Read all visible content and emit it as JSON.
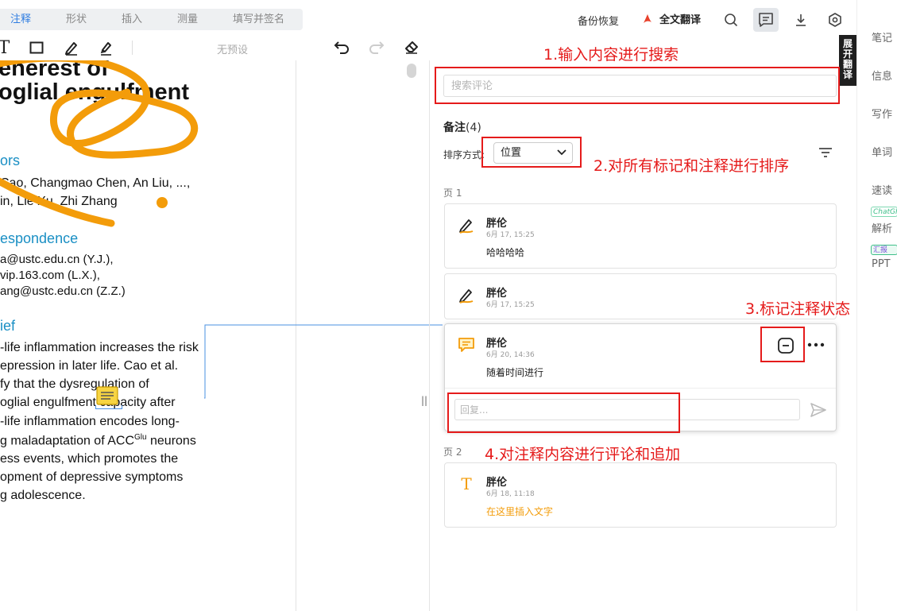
{
  "tabs": [
    {
      "label": "注释",
      "active": true
    },
    {
      "label": "形状",
      "active": false
    },
    {
      "label": "插入",
      "active": false
    },
    {
      "label": "测量",
      "active": false
    },
    {
      "label": "填写并签名",
      "active": false
    }
  ],
  "tools": {
    "text_tool_glyph": "T",
    "preset_label": "无预设"
  },
  "topbar": {
    "backup_label": "备份恢复",
    "translate_label": "全文翻译",
    "expand_translate_label": "展开翻译"
  },
  "rail": {
    "items": [
      "笔记",
      "信息",
      "写作",
      "单词",
      "速读",
      "解析",
      "PPT"
    ],
    "badge_chatgpt": "ChatGPT",
    "badge_summary": "汇报"
  },
  "document": {
    "title_line1": "enerest of",
    "title_line2": "oglial engulfment",
    "authors_heading": "ors",
    "authors_line1": "Cao, Changmao Chen, An Liu, ...,",
    "authors_line2": "in, Lie Xu, Zhi Zhang",
    "correspondence_heading": "espondence",
    "corr_line1": "a@ustc.edu.cn (Y.J.),",
    "corr_line2": "vip.163.com (L.X.),",
    "corr_line3": "ang@ustc.edu.cn (Z.Z.)",
    "brief_heading": "ief",
    "brief_lines": [
      "-life inflammation increases the risk",
      "epression in later life. Cao et al.",
      "fy that the dysregulation of",
      "oglial engulfment capacity after",
      "-life inflammation encodes long-",
      "g maladaptation of ACC",
      "ess events, which promotes the",
      "opment of depressive symptoms",
      "g adolescence."
    ],
    "brief_sup": "Glu",
    "brief_after_sup": " neurons"
  },
  "notes": {
    "search_placeholder": "搜索评论",
    "title": "备注",
    "count": "(4)",
    "sort_label": "排序方式:",
    "sort_value": "位置",
    "page1_label": "页 1",
    "page2_label": "页 2",
    "cards": [
      {
        "author": "胖伦",
        "time": "6月 17, 15:25",
        "body": "哈哈哈哈",
        "icon": "pen-icon"
      },
      {
        "author": "胖伦",
        "time": "6月 17, 15:25",
        "body": "",
        "icon": "pen-icon"
      },
      {
        "author": "胖伦",
        "time": "6月 20, 14:36",
        "body": "随着时间进行",
        "icon": "comment-icon"
      },
      {
        "author": "胖伦",
        "time": "6月 18, 11:18",
        "body": "在这里插入文字",
        "icon": "text-icon"
      }
    ],
    "reply_placeholder": "回复..."
  },
  "annotations": {
    "a1": "1.输入内容进行搜索",
    "a2": "2.对所有标记和注释进行排序",
    "a3": "3.标记注释状态",
    "a4": "4.对注释内容进行评论和追加"
  },
  "colors": {
    "accent": "#2f7de1",
    "highlight_orange": "#f39c0a",
    "annotation_red": "#e51b1b",
    "heading_blue": "#1a8fc4"
  }
}
